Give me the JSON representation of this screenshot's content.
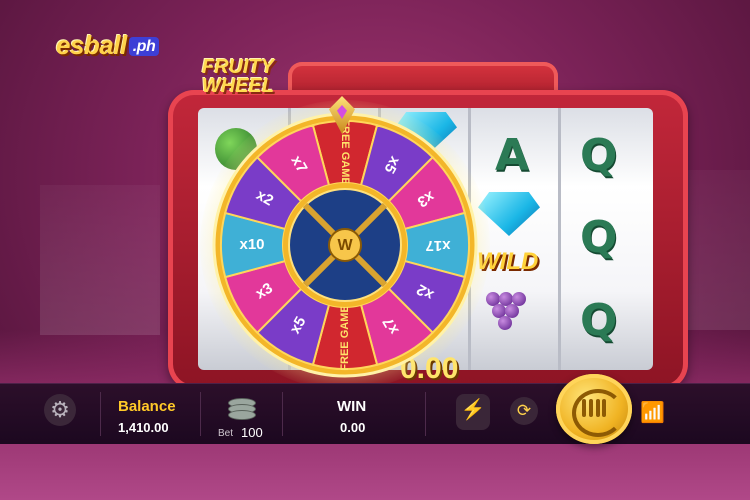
{
  "brand": {
    "logo_text": "esball",
    "logo_suffix": ".ph"
  },
  "game": {
    "title_line1": "FRUITY",
    "title_line2": "WHEEL"
  },
  "reels": {
    "wild_label": "WILD",
    "letters": [
      "A",
      "Q",
      "Q",
      "Q"
    ],
    "partial_win": "0.00"
  },
  "wheel": {
    "center_label": "W",
    "segments": [
      "FREE GAME",
      "x5",
      "x3",
      "x17",
      "x2",
      "x7",
      "FREE GAME",
      "x5",
      "x3",
      "x10",
      "x2",
      "x7"
    ],
    "colors": [
      "#d1272f",
      "#7a3cc8",
      "#e2389a",
      "#3fb0d6",
      "#7a3cc8",
      "#e2389a",
      "#d1272f",
      "#7a3cc8",
      "#e2389a",
      "#3fb0d6",
      "#7a3cc8",
      "#e2389a"
    ]
  },
  "bottom_bar": {
    "settings_icon": "gear-icon",
    "balance_label": "Balance",
    "balance_value": "1,410.00",
    "bet_label": "Bet",
    "bet_value": "100",
    "win_label": "WIN",
    "win_value": "0.00",
    "turbo_icon": "lightning-icon",
    "autoplay_icon": "auto-spin-icon",
    "spin_icon": "spin-icon",
    "signal_icon": "wifi-icon"
  }
}
